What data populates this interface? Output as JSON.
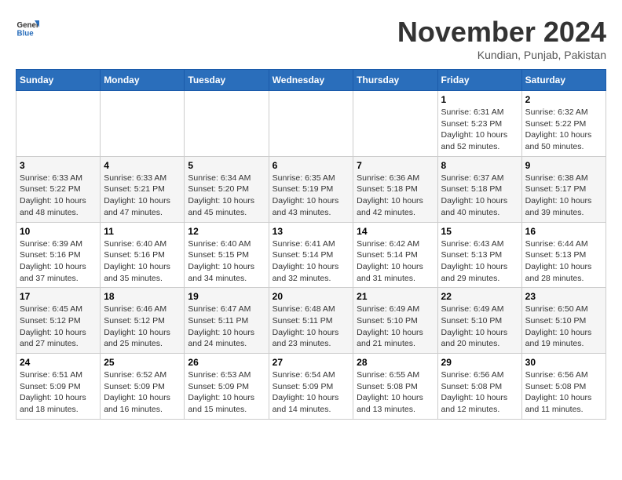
{
  "logo": {
    "general": "General",
    "blue": "Blue"
  },
  "title": {
    "month": "November 2024",
    "location": "Kundian, Punjab, Pakistan"
  },
  "headers": [
    "Sunday",
    "Monday",
    "Tuesday",
    "Wednesday",
    "Thursday",
    "Friday",
    "Saturday"
  ],
  "weeks": [
    [
      {
        "day": "",
        "info": ""
      },
      {
        "day": "",
        "info": ""
      },
      {
        "day": "",
        "info": ""
      },
      {
        "day": "",
        "info": ""
      },
      {
        "day": "",
        "info": ""
      },
      {
        "day": "1",
        "info": "Sunrise: 6:31 AM\nSunset: 5:23 PM\nDaylight: 10 hours and 52 minutes."
      },
      {
        "day": "2",
        "info": "Sunrise: 6:32 AM\nSunset: 5:22 PM\nDaylight: 10 hours and 50 minutes."
      }
    ],
    [
      {
        "day": "3",
        "info": "Sunrise: 6:33 AM\nSunset: 5:22 PM\nDaylight: 10 hours and 48 minutes."
      },
      {
        "day": "4",
        "info": "Sunrise: 6:33 AM\nSunset: 5:21 PM\nDaylight: 10 hours and 47 minutes."
      },
      {
        "day": "5",
        "info": "Sunrise: 6:34 AM\nSunset: 5:20 PM\nDaylight: 10 hours and 45 minutes."
      },
      {
        "day": "6",
        "info": "Sunrise: 6:35 AM\nSunset: 5:19 PM\nDaylight: 10 hours and 43 minutes."
      },
      {
        "day": "7",
        "info": "Sunrise: 6:36 AM\nSunset: 5:18 PM\nDaylight: 10 hours and 42 minutes."
      },
      {
        "day": "8",
        "info": "Sunrise: 6:37 AM\nSunset: 5:18 PM\nDaylight: 10 hours and 40 minutes."
      },
      {
        "day": "9",
        "info": "Sunrise: 6:38 AM\nSunset: 5:17 PM\nDaylight: 10 hours and 39 minutes."
      }
    ],
    [
      {
        "day": "10",
        "info": "Sunrise: 6:39 AM\nSunset: 5:16 PM\nDaylight: 10 hours and 37 minutes."
      },
      {
        "day": "11",
        "info": "Sunrise: 6:40 AM\nSunset: 5:16 PM\nDaylight: 10 hours and 35 minutes."
      },
      {
        "day": "12",
        "info": "Sunrise: 6:40 AM\nSunset: 5:15 PM\nDaylight: 10 hours and 34 minutes."
      },
      {
        "day": "13",
        "info": "Sunrise: 6:41 AM\nSunset: 5:14 PM\nDaylight: 10 hours and 32 minutes."
      },
      {
        "day": "14",
        "info": "Sunrise: 6:42 AM\nSunset: 5:14 PM\nDaylight: 10 hours and 31 minutes."
      },
      {
        "day": "15",
        "info": "Sunrise: 6:43 AM\nSunset: 5:13 PM\nDaylight: 10 hours and 29 minutes."
      },
      {
        "day": "16",
        "info": "Sunrise: 6:44 AM\nSunset: 5:13 PM\nDaylight: 10 hours and 28 minutes."
      }
    ],
    [
      {
        "day": "17",
        "info": "Sunrise: 6:45 AM\nSunset: 5:12 PM\nDaylight: 10 hours and 27 minutes."
      },
      {
        "day": "18",
        "info": "Sunrise: 6:46 AM\nSunset: 5:12 PM\nDaylight: 10 hours and 25 minutes."
      },
      {
        "day": "19",
        "info": "Sunrise: 6:47 AM\nSunset: 5:11 PM\nDaylight: 10 hours and 24 minutes."
      },
      {
        "day": "20",
        "info": "Sunrise: 6:48 AM\nSunset: 5:11 PM\nDaylight: 10 hours and 23 minutes."
      },
      {
        "day": "21",
        "info": "Sunrise: 6:49 AM\nSunset: 5:10 PM\nDaylight: 10 hours and 21 minutes."
      },
      {
        "day": "22",
        "info": "Sunrise: 6:49 AM\nSunset: 5:10 PM\nDaylight: 10 hours and 20 minutes."
      },
      {
        "day": "23",
        "info": "Sunrise: 6:50 AM\nSunset: 5:10 PM\nDaylight: 10 hours and 19 minutes."
      }
    ],
    [
      {
        "day": "24",
        "info": "Sunrise: 6:51 AM\nSunset: 5:09 PM\nDaylight: 10 hours and 18 minutes."
      },
      {
        "day": "25",
        "info": "Sunrise: 6:52 AM\nSunset: 5:09 PM\nDaylight: 10 hours and 16 minutes."
      },
      {
        "day": "26",
        "info": "Sunrise: 6:53 AM\nSunset: 5:09 PM\nDaylight: 10 hours and 15 minutes."
      },
      {
        "day": "27",
        "info": "Sunrise: 6:54 AM\nSunset: 5:09 PM\nDaylight: 10 hours and 14 minutes."
      },
      {
        "day": "28",
        "info": "Sunrise: 6:55 AM\nSunset: 5:08 PM\nDaylight: 10 hours and 13 minutes."
      },
      {
        "day": "29",
        "info": "Sunrise: 6:56 AM\nSunset: 5:08 PM\nDaylight: 10 hours and 12 minutes."
      },
      {
        "day": "30",
        "info": "Sunrise: 6:56 AM\nSunset: 5:08 PM\nDaylight: 10 hours and 11 minutes."
      }
    ]
  ]
}
